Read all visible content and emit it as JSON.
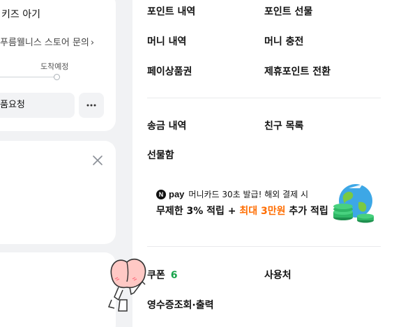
{
  "order_card": {
    "title": "키즈 아기",
    "store_link": "푸름웰니스 스토어 문의",
    "store_link_chevron": "›",
    "track_label": "도착예정",
    "action_label": "품요청",
    "more_label": "···"
  },
  "menu": {
    "points_history": "포인트 내역",
    "points_gift": "포인트 선물",
    "money_history": "머니 내역",
    "money_charge": "머니 충전",
    "pay_voucher": "페이상품권",
    "partner_points": "제휴포인트 전환",
    "transfer_history": "송금 내역",
    "friends_list": "친구 목록",
    "gift_box": "선물함",
    "coupon": "쿠폰",
    "coupon_count": "6",
    "usage_places": "사용처",
    "receipt": "영수증조회·출력"
  },
  "banner": {
    "badge": "N",
    "brand": "pay",
    "line1": "머니카드 30초 발급! 해외 결제 시",
    "line2_a": "무제한 3% 적립 + ",
    "line2_b": "최대 3만원",
    "line2_c": " 추가 적립",
    "accent_color": "#ff6d00"
  },
  "colors": {
    "coupon_count": "#17a34a",
    "background": "#f1f2f4"
  }
}
